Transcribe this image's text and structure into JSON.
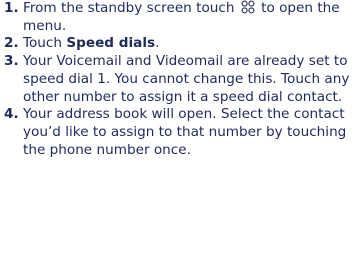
{
  "steps": [
    {
      "number": "1.",
      "before": "From the standby screen touch",
      "icon": "menu-grid-icon",
      "after": "to open the menu."
    },
    {
      "number": "2.",
      "before": "Touch",
      "bold": "Speed dials",
      "after": "."
    },
    {
      "number": "3.",
      "text": "Your Voicemail and Videomail are already set to speed dial 1. You cannot change this. Touch any other number to assign it a speed dial contact."
    },
    {
      "number": "4.",
      "text": "Your address book will open. Select the contact you’d like to assign to that number by touching the phone number once."
    }
  ],
  "colors": {
    "text": "#1f2a5c"
  }
}
